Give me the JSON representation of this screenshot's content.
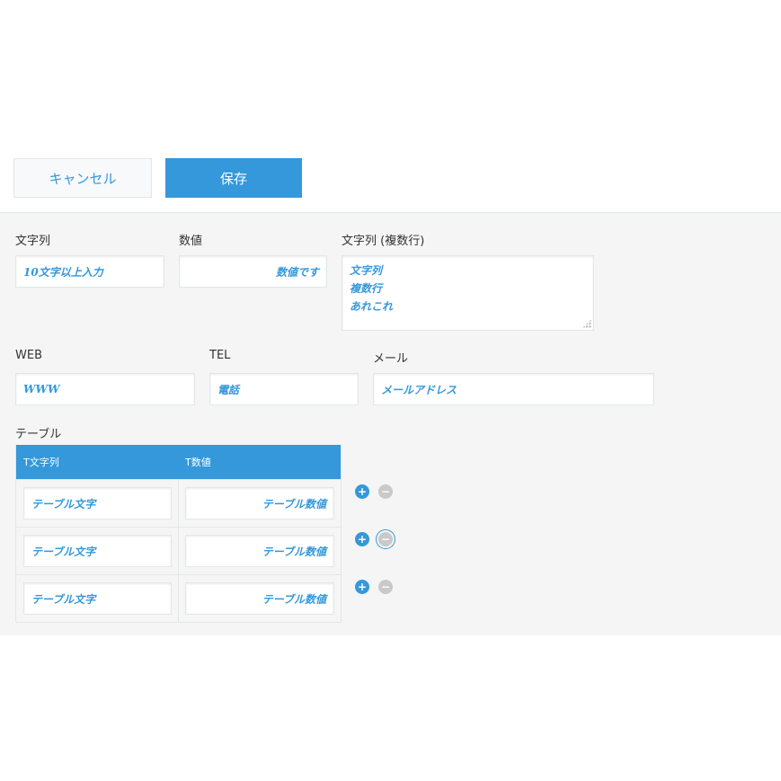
{
  "toolbar": {
    "cancel_label": "キャンセル",
    "save_label": "保存"
  },
  "form": {
    "string_label": "文字列",
    "string_value": "10文字以上入力",
    "number_label": "数値",
    "number_value": "数値です",
    "multiline_label": "文字列 (複数行)",
    "multiline_lines": [
      "文字列",
      "複数行",
      "あれこれ"
    ],
    "web_label": "WEB",
    "web_value": "WWW",
    "tel_label": "TEL",
    "tel_value": "電話",
    "mail_label": "メール",
    "mail_value": "メールアドレス",
    "table_label": "テーブル"
  },
  "table": {
    "headers": [
      "T文字列",
      "T数値"
    ],
    "rows": [
      {
        "text": "テーブル文字",
        "number": "テーブル数値"
      },
      {
        "text": "テーブル文字",
        "number": "テーブル数値"
      },
      {
        "text": "テーブル文字",
        "number": "テーブル数値"
      }
    ],
    "add_symbol": "+",
    "remove_symbol": "−"
  },
  "colors": {
    "accent": "#3498db",
    "panel_bg": "#f5f5f5",
    "border": "#e3e7e8",
    "disabled": "#c9c9c9"
  }
}
